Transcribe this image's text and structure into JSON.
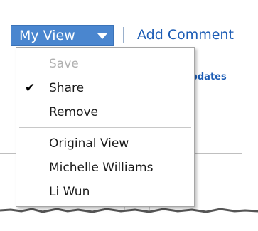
{
  "toolbar": {
    "my_view_label": "My View",
    "add_comment_label": "Add Comment"
  },
  "background": {
    "updates_label": "Updates"
  },
  "menu": {
    "items": [
      {
        "label": "Save",
        "enabled": false,
        "checked": false
      },
      {
        "label": "Share",
        "enabled": true,
        "checked": true
      },
      {
        "label": "Remove",
        "enabled": true,
        "checked": false
      }
    ],
    "views": [
      {
        "label": "Original View"
      },
      {
        "label": "Michelle Williams"
      },
      {
        "label": "Li Wun"
      }
    ],
    "check_glyph": "✔"
  },
  "colors": {
    "button_bg": "#4a86cf",
    "link": "#1d5db5",
    "disabled_text": "#b0b0b0"
  }
}
